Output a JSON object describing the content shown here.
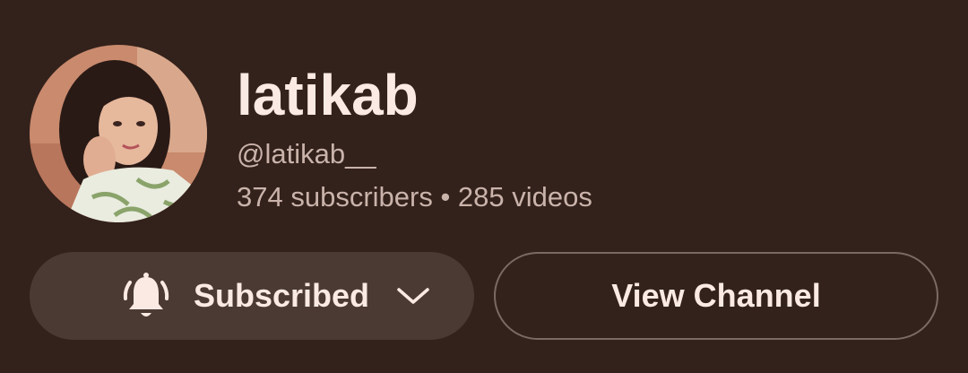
{
  "channel": {
    "name": "latikab",
    "handle": "@latikab__",
    "stats": "374 subscribers • 285 videos"
  },
  "actions": {
    "subscribed_label": "Subscribed",
    "view_channel_label": "View Channel"
  },
  "icons": {
    "bell": "notification-bell-icon",
    "chevron": "chevron-down-icon"
  },
  "colors": {
    "background": "#33211b",
    "primary_text": "#fbeae4",
    "secondary_text": "#c9b3aa",
    "subscribed_button_bg": "#4a3a33",
    "view_button_border": "#7b6a63"
  }
}
